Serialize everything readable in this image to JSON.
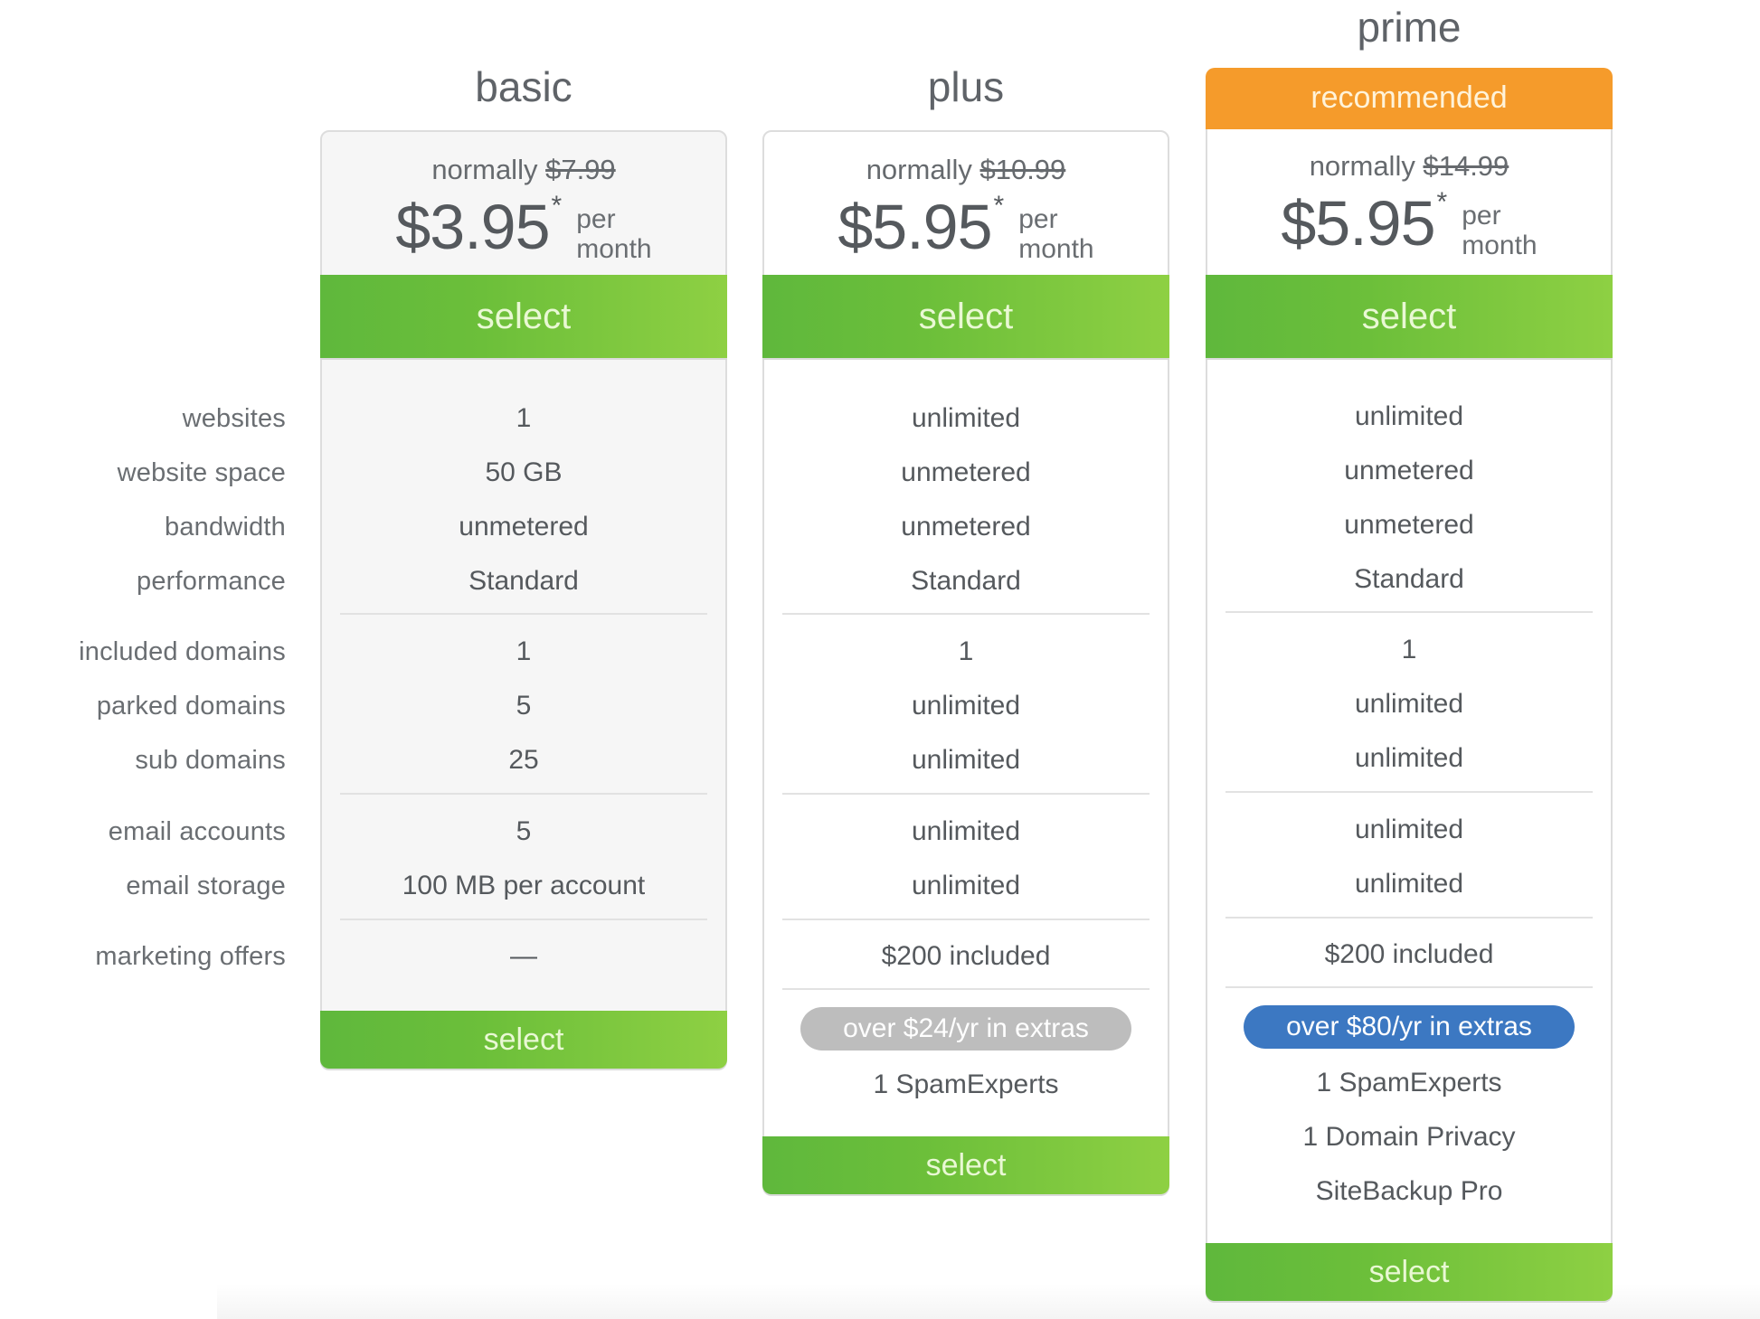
{
  "labels": [
    "websites",
    "website space",
    "bandwidth",
    "performance",
    "included domains",
    "parked domains",
    "sub domains",
    "email accounts",
    "email storage",
    "marketing offers"
  ],
  "colors": {
    "recommended": "#f59b2b",
    "select_green_start": "#5fb83c",
    "select_green_end": "#8ed043",
    "badge_gray": "#bdbdbd",
    "badge_blue": "#3c78c2"
  },
  "plans": [
    {
      "name": "basic",
      "normally_label": "normally",
      "old_price": "$7.99",
      "price": "$3.95",
      "asterisk": "*",
      "per": "per",
      "month": "month",
      "select_label": "select",
      "features": [
        "1",
        "50 GB",
        "unmetered",
        "Standard",
        "1",
        "5",
        "25",
        "5",
        "100 MB per account",
        "—"
      ],
      "bottom_select_label": "select"
    },
    {
      "name": "plus",
      "normally_label": "normally",
      "old_price": "$10.99",
      "price": "$5.95",
      "asterisk": "*",
      "per": "per",
      "month": "month",
      "select_label": "select",
      "features": [
        "unlimited",
        "unmetered",
        "unmetered",
        "Standard",
        "1",
        "unlimited",
        "unlimited",
        "unlimited",
        "unlimited",
        "$200 included"
      ],
      "extras_badge": "over $24/yr in extras",
      "extras": [
        "1 SpamExperts"
      ],
      "bottom_select_label": "select"
    },
    {
      "name": "prime",
      "recommended_label": "recommended",
      "normally_label": "normally",
      "old_price": "$14.99",
      "price": "$5.95",
      "asterisk": "*",
      "per": "per",
      "month": "month",
      "select_label": "select",
      "features": [
        "unlimited",
        "unmetered",
        "unmetered",
        "Standard",
        "1",
        "unlimited",
        "unlimited",
        "unlimited",
        "unlimited",
        "$200 included"
      ],
      "extras_badge": "over $80/yr in extras",
      "extras": [
        "1 SpamExperts",
        "1 Domain Privacy",
        "SiteBackup Pro"
      ],
      "bottom_select_label": "select"
    }
  ]
}
